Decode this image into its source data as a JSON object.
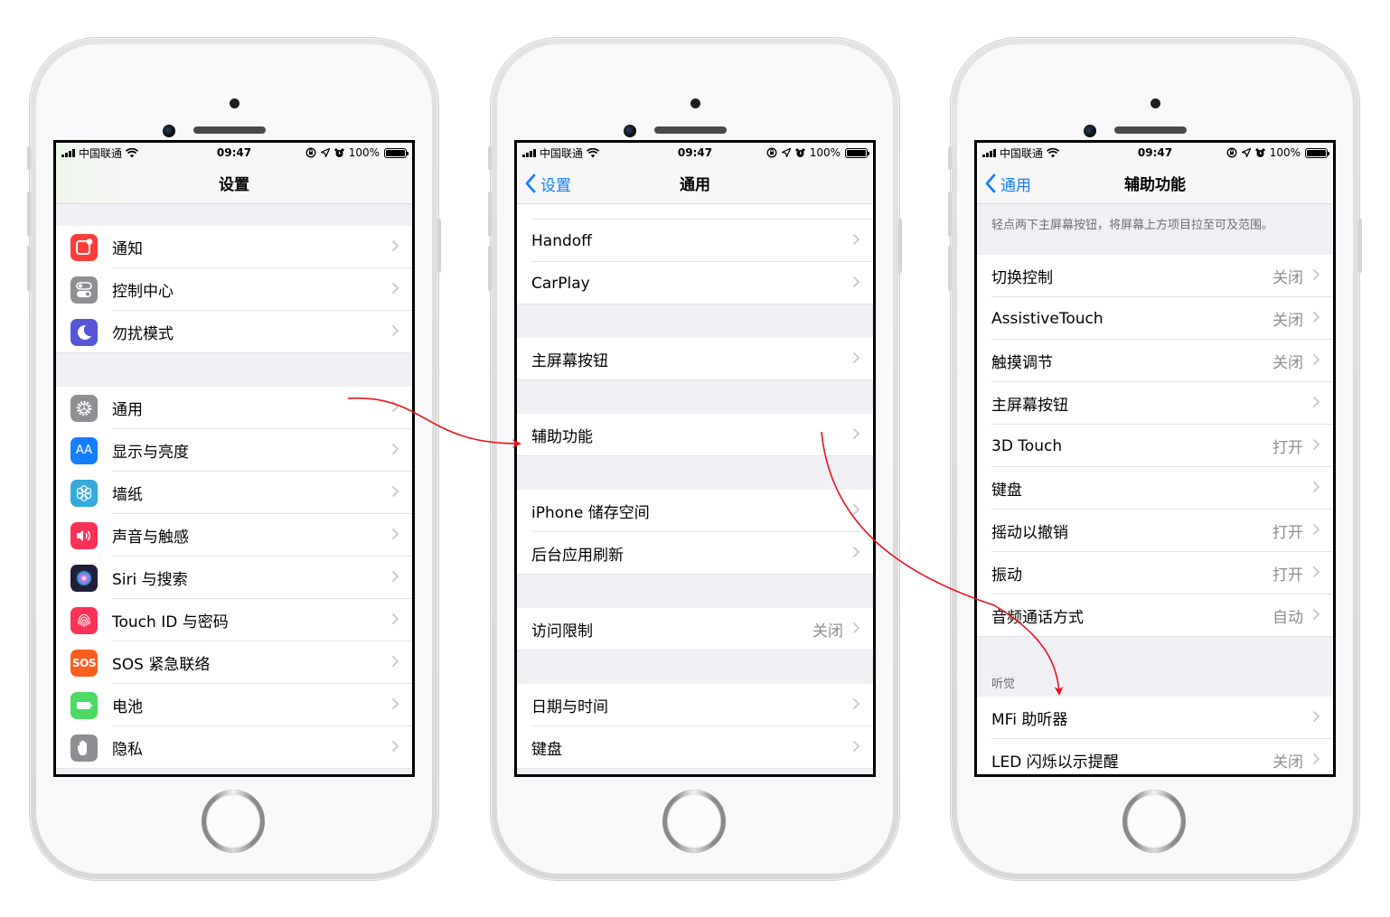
{
  "status_bar": {
    "carrier": "中国联通",
    "time": "09:47",
    "battery": "100%"
  },
  "phones": [
    {
      "nav": {
        "title": "设置",
        "back": null
      },
      "sections": [
        {
          "gap": "top",
          "rows": [
            {
              "label": "通知",
              "icon": "notifications-icon",
              "color": "#fc3d39"
            },
            {
              "label": "控制中心",
              "icon": "control-center-icon",
              "color": "#8e8e93"
            },
            {
              "label": "勿扰模式",
              "icon": "do-not-disturb-moon-icon",
              "color": "#5856d6"
            }
          ]
        },
        {
          "gap": "large",
          "rows": [
            {
              "label": "通用",
              "icon": "gear-icon",
              "color": "#8e8e93"
            },
            {
              "label": "显示与亮度",
              "icon": "display-aa-icon",
              "color": "#157efb",
              "glyph": "AA"
            },
            {
              "label": "墙纸",
              "icon": "wallpaper-flower-icon",
              "color": "#35aadc"
            },
            {
              "label": "声音与触感",
              "icon": "sound-speaker-icon",
              "color": "#fc3158"
            },
            {
              "label": "Siri 与搜索",
              "icon": "siri-icon",
              "color": "#1f1f3a"
            },
            {
              "label": "Touch ID 与密码",
              "icon": "fingerprint-icon",
              "color": "#fc3158"
            },
            {
              "label": "SOS 紧急联络",
              "icon": "sos-icon",
              "color": "#fd5d1f",
              "glyph": "SOS"
            },
            {
              "label": "电池",
              "icon": "battery-icon",
              "color": "#4cd964"
            },
            {
              "label": "隐私",
              "icon": "privacy-hand-icon",
              "color": "#8e8e93"
            }
          ]
        }
      ]
    },
    {
      "nav": {
        "title": "通用",
        "back": "设置"
      },
      "sections": [
        {
          "gap": "partial",
          "rows": [
            {
              "label": "Handoff"
            },
            {
              "label": "CarPlay"
            }
          ]
        },
        {
          "gap": "medium",
          "rows": [
            {
              "label": "主屏幕按钮"
            }
          ]
        },
        {
          "gap": "medium",
          "rows": [
            {
              "label": "辅助功能"
            }
          ]
        },
        {
          "gap": "medium",
          "rows": [
            {
              "label": "iPhone 储存空间"
            },
            {
              "label": "后台应用刷新"
            }
          ]
        },
        {
          "gap": "medium",
          "rows": [
            {
              "label": "访问限制",
              "value": "关闭"
            }
          ]
        },
        {
          "gap": "medium",
          "rows": [
            {
              "label": "日期与时间"
            },
            {
              "label": "键盘"
            }
          ]
        }
      ]
    },
    {
      "nav": {
        "title": "辅助功能",
        "back": "通用"
      },
      "note": "轻点两下主屏幕按钮，将屏幕上方项目拉至可及范围。",
      "sections": [
        {
          "gap": "note",
          "rows": [
            {
              "label": "切换控制",
              "value": "关闭"
            },
            {
              "label": "AssistiveTouch",
              "value": "关闭"
            },
            {
              "label": "触摸调节",
              "value": "关闭"
            },
            {
              "label": "主屏幕按钮"
            },
            {
              "label": "3D Touch",
              "value": "打开"
            },
            {
              "label": "键盘"
            },
            {
              "label": "摇动以撤销",
              "value": "打开"
            },
            {
              "label": "振动",
              "value": "打开"
            },
            {
              "label": "音频通话方式",
              "value": "自动"
            }
          ]
        },
        {
          "gap": "titled",
          "title": "听觉",
          "rows": [
            {
              "label": "MFi 助听器"
            },
            {
              "label": "LED 闪烁以示提醒",
              "value": "关闭"
            }
          ]
        }
      ]
    }
  ],
  "annotations": {
    "arrow_color": "#e8141b",
    "arrows": [
      {
        "from": "设置 > 通用",
        "to": "通用 > 辅助功能"
      },
      {
        "from": "通用 > 辅助功能",
        "to": "辅助功能 > 听觉 > MFi 助听器"
      }
    ]
  }
}
